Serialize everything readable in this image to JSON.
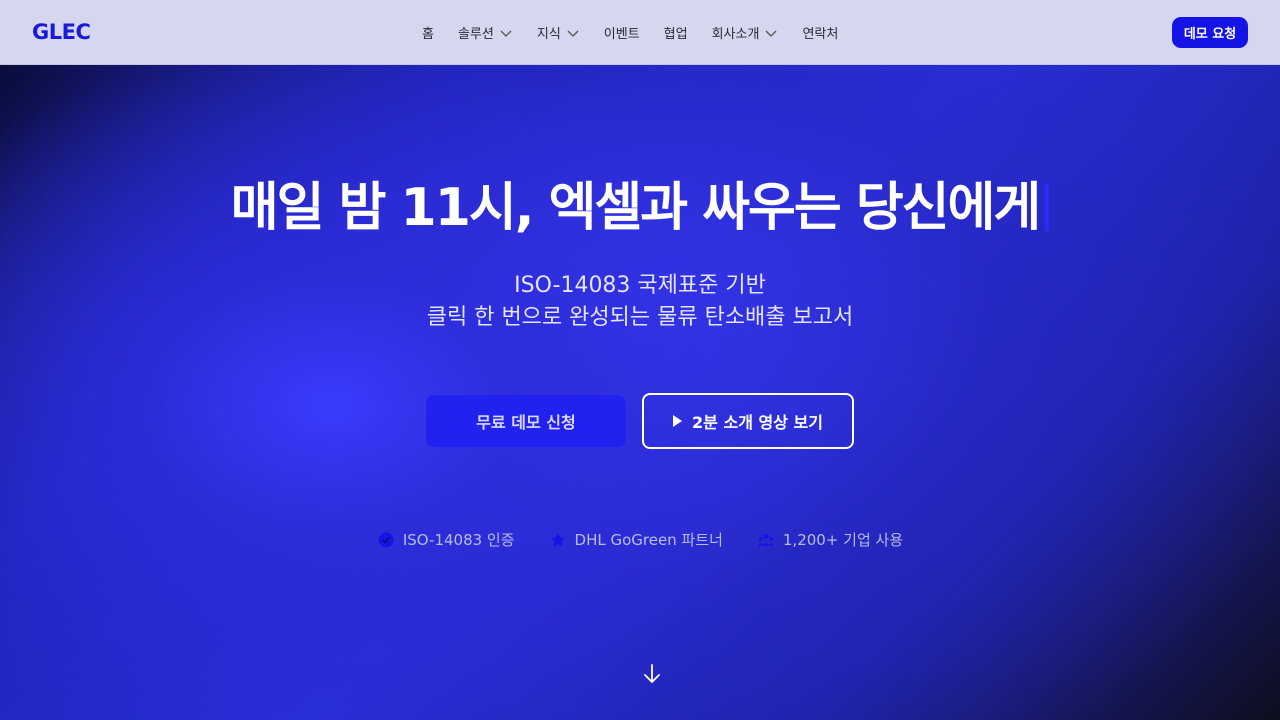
{
  "header": {
    "logo": "GLEC",
    "nav": [
      {
        "label": "홈",
        "has_dropdown": false
      },
      {
        "label": "솔루션",
        "has_dropdown": true
      },
      {
        "label": "지식",
        "has_dropdown": true
      },
      {
        "label": "이벤트",
        "has_dropdown": false
      },
      {
        "label": "협업",
        "has_dropdown": false
      },
      {
        "label": "회사소개",
        "has_dropdown": true
      },
      {
        "label": "연락처",
        "has_dropdown": false
      }
    ],
    "demo_button": "데모 요청"
  },
  "hero": {
    "headline": "매일 밤 11시, 엑셀과 싸우는 당신에게",
    "subtitle_line1": "ISO-14083 국제표준 기반",
    "subtitle_line2": "클릭 한 번으로 완성되는 물류 탄소배출 보고서",
    "primary_button": "무료 데모 신청",
    "secondary_button": "2분 소개 영상 보기",
    "badges": [
      {
        "icon": "check-circle-icon",
        "label": "ISO-14083 인증"
      },
      {
        "icon": "star-icon",
        "label": "DHL GoGreen 파트너"
      },
      {
        "icon": "users-icon",
        "label": "1,200+ 기업 사용"
      }
    ]
  },
  "colors": {
    "brand": "#1414e6",
    "header_bg": "#d6d7ee",
    "hero_accent": "#2a2fd6"
  }
}
